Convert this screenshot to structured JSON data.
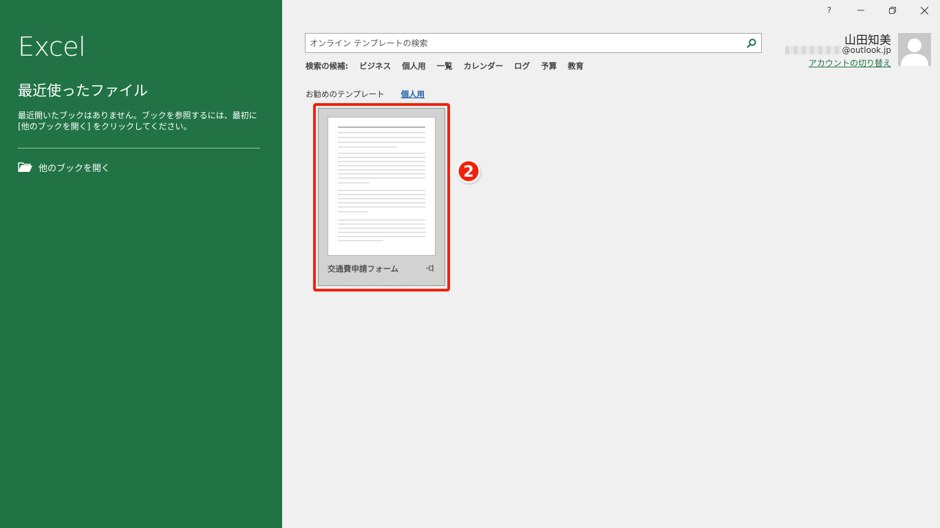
{
  "sidebar": {
    "app_title": "Excel",
    "recent_heading": "最近使ったファイル",
    "recent_description": "最近開いたブックはありません。ブックを参照するには、最初に [他のブックを開く] をクリックしてください。",
    "open_other_label": "他のブックを開く",
    "icon": "folder-open-icon",
    "background_color": "#217346"
  },
  "window_controls": {
    "help": "?",
    "icons": [
      "minimize-icon",
      "restore-icon",
      "close-icon"
    ]
  },
  "search": {
    "placeholder": "オンライン テンプレートの検索",
    "value": "",
    "icon": "search-icon"
  },
  "suggestions": {
    "label": "検索の候補:",
    "items": [
      "ビジネス",
      "個人用",
      "一覧",
      "カレンダー",
      "ログ",
      "予算",
      "教育"
    ]
  },
  "account": {
    "name": "山田知美",
    "email_domain": "@outlook.jp",
    "switch_label": "アカウントの切り替え",
    "avatar_icon": "user-avatar-icon"
  },
  "tabs": [
    {
      "label": "お勧めのテンプレート",
      "active": false
    },
    {
      "label": "個人用",
      "active": true
    }
  ],
  "templates": [
    {
      "label": "交通費申請フォーム",
      "pin_icon": "pin-icon"
    }
  ],
  "annotation": {
    "step_number": "2",
    "highlight_color": "#f0220c"
  }
}
